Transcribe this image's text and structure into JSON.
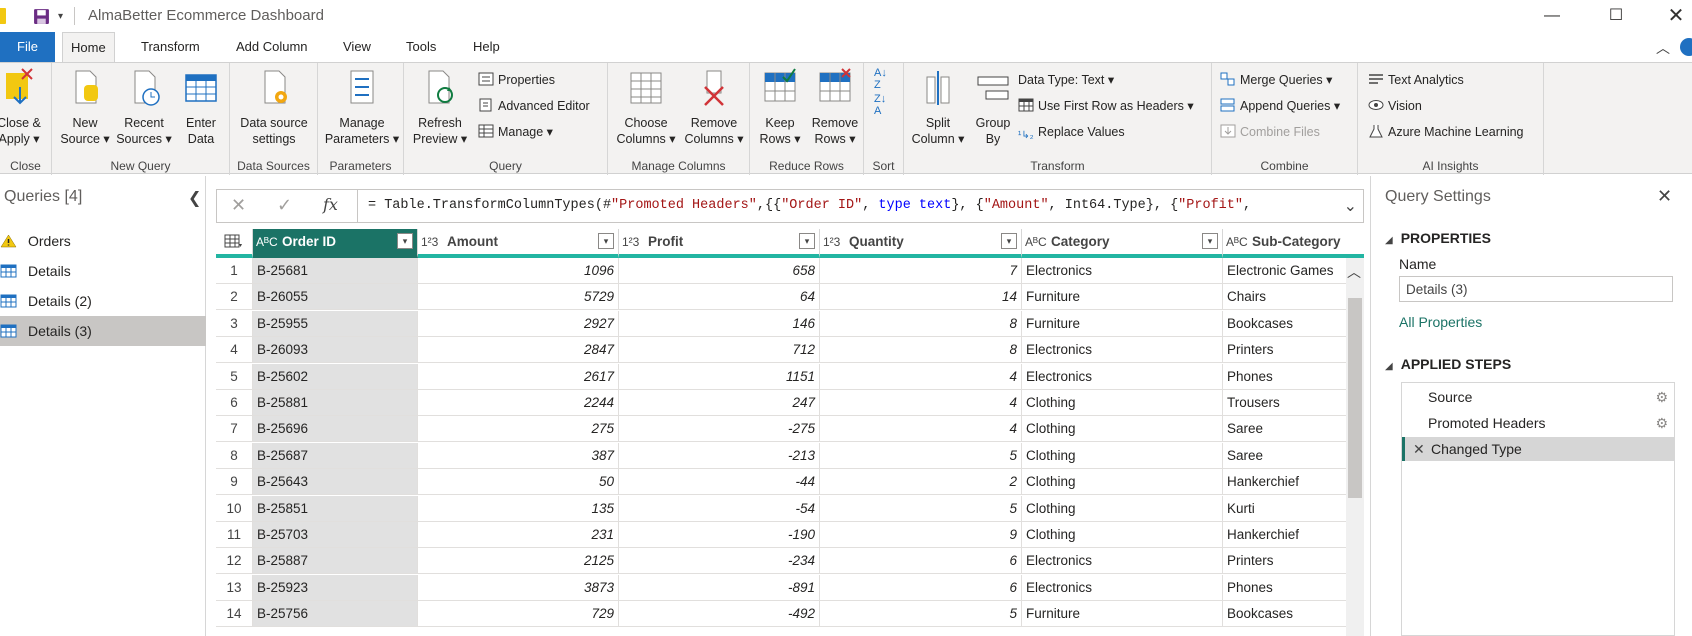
{
  "window": {
    "title": "AlmaBetter Ecommerce Dashboard"
  },
  "tabs": [
    "File",
    "Home",
    "Transform",
    "Add Column",
    "View",
    "Tools",
    "Help"
  ],
  "ribbon": {
    "close": {
      "label1": "Close &",
      "label2": "Apply",
      "group": "Close"
    },
    "new_query": {
      "new_source": [
        "New",
        "Source"
      ],
      "recent_sources": [
        "Recent",
        "Sources"
      ],
      "enter_data": [
        "Enter",
        "Data"
      ],
      "group": "New Query"
    },
    "data_sources": {
      "button": [
        "Data source",
        "settings"
      ],
      "group": "Data Sources"
    },
    "parameters": {
      "button": [
        "Manage",
        "Parameters"
      ],
      "group": "Parameters"
    },
    "query": {
      "refresh": [
        "Refresh",
        "Preview"
      ],
      "properties": "Properties",
      "advanced_editor": "Advanced Editor",
      "manage": "Manage",
      "group": "Query"
    },
    "manage_columns": {
      "choose": [
        "Choose",
        "Columns"
      ],
      "remove": [
        "Remove",
        "Columns"
      ],
      "group": "Manage Columns"
    },
    "reduce_rows": {
      "keep": [
        "Keep",
        "Rows"
      ],
      "remove": [
        "Remove",
        "Rows"
      ],
      "group": "Reduce Rows"
    },
    "sort": {
      "group": "Sort"
    },
    "transform": {
      "split": [
        "Split",
        "Column"
      ],
      "group_by": [
        "Group",
        "By"
      ],
      "data_type": "Data Type: Text",
      "first_row": "Use First Row as Headers",
      "replace": "Replace Values",
      "group": "Transform"
    },
    "combine": {
      "merge": "Merge Queries",
      "append": "Append Queries",
      "combine_files": "Combine Files",
      "group": "Combine"
    },
    "ai": {
      "text": "Text Analytics",
      "vision": "Vision",
      "aml": "Azure Machine Learning",
      "group": "AI Insights"
    }
  },
  "queries_pane": {
    "title": "Queries [4]",
    "items": [
      {
        "label": "Orders",
        "warning": true
      },
      {
        "label": "Details",
        "warning": false
      },
      {
        "label": "Details (2)",
        "warning": false
      },
      {
        "label": "Details (3)",
        "warning": false,
        "selected": true
      }
    ]
  },
  "formula_bar": {
    "fx": "fx",
    "text_prefix": "= Table.TransformColumnTypes(#",
    "s1": "\"Promoted Headers\"",
    "t2": ",{{",
    "s2": "\"Order ID\"",
    "t3": ", ",
    "k1": "type text",
    "t4": "}, {",
    "s3": "\"Amount\"",
    "t5": ", Int64.Type}, {",
    "s4": "\"Profit\"",
    "t6": ","
  },
  "grid": {
    "columns": [
      {
        "type": "ABC",
        "name": "Order ID"
      },
      {
        "type": "123",
        "name": "Amount"
      },
      {
        "type": "123",
        "name": "Profit"
      },
      {
        "type": "123",
        "name": "Quantity"
      },
      {
        "type": "ABC",
        "name": "Category"
      },
      {
        "type": "ABC",
        "name": "Sub-Category"
      }
    ],
    "rows": [
      [
        "1",
        "B-25681",
        "1096",
        "658",
        "7",
        "Electronics",
        "Electronic Games"
      ],
      [
        "2",
        "B-26055",
        "5729",
        "64",
        "14",
        "Furniture",
        "Chairs"
      ],
      [
        "3",
        "B-25955",
        "2927",
        "146",
        "8",
        "Furniture",
        "Bookcases"
      ],
      [
        "4",
        "B-26093",
        "2847",
        "712",
        "8",
        "Electronics",
        "Printers"
      ],
      [
        "5",
        "B-25602",
        "2617",
        "1151",
        "4",
        "Electronics",
        "Phones"
      ],
      [
        "6",
        "B-25881",
        "2244",
        "247",
        "4",
        "Clothing",
        "Trousers"
      ],
      [
        "7",
        "B-25696",
        "275",
        "-275",
        "4",
        "Clothing",
        "Saree"
      ],
      [
        "8",
        "B-25687",
        "387",
        "-213",
        "5",
        "Clothing",
        "Saree"
      ],
      [
        "9",
        "B-25643",
        "50",
        "-44",
        "2",
        "Clothing",
        "Hankerchief"
      ],
      [
        "10",
        "B-25851",
        "135",
        "-54",
        "5",
        "Clothing",
        "Kurti"
      ],
      [
        "11",
        "B-25703",
        "231",
        "-190",
        "9",
        "Clothing",
        "Hankerchief"
      ],
      [
        "12",
        "B-25887",
        "2125",
        "-234",
        "6",
        "Electronics",
        "Printers"
      ],
      [
        "13",
        "B-25923",
        "3873",
        "-891",
        "6",
        "Electronics",
        "Phones"
      ],
      [
        "14",
        "B-25756",
        "729",
        "-492",
        "5",
        "Furniture",
        "Bookcases"
      ]
    ]
  },
  "settings_pane": {
    "title": "Query Settings",
    "properties": "PROPERTIES",
    "name_label": "Name",
    "name_value": "Details (3)",
    "all_properties": "All Properties",
    "applied_steps": "APPLIED STEPS",
    "steps": [
      "Source",
      "Promoted Headers",
      "Changed Type"
    ]
  },
  "colors": {
    "file_tab": "#1f70c1",
    "accent": "#1b7366",
    "header_underline": "#22b5a2"
  }
}
